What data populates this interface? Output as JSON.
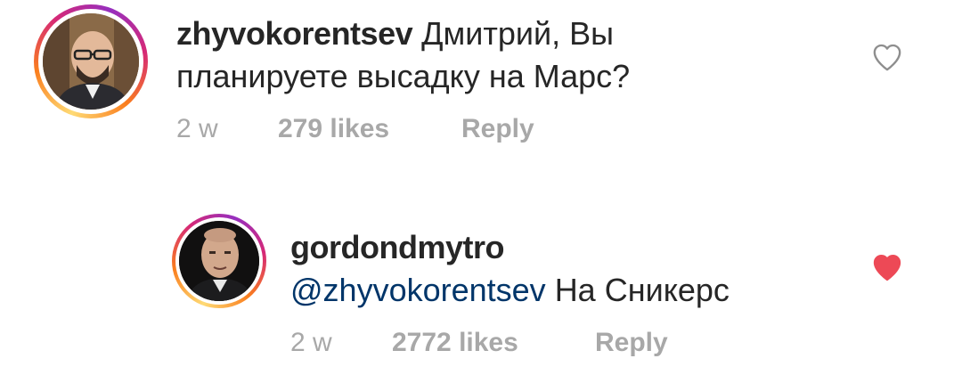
{
  "comments": [
    {
      "username": "zhyvokorentsev",
      "mention": "",
      "text_line1": "Дмитрий, Вы",
      "text_line2": "планируете высадку на Марс?",
      "time": "2 w",
      "likes": "279 likes",
      "reply_label": "Reply",
      "liked": false,
      "avatar_icon": "user-avatar"
    },
    {
      "username": "gordondmytro",
      "mention": "@zhyvokorentsev",
      "text": "На Сникерс",
      "time": "2 w",
      "likes": "2772 likes",
      "reply_label": "Reply",
      "liked": true,
      "avatar_icon": "user-avatar"
    }
  ],
  "colors": {
    "heart_liked": "#ed4956",
    "heart_outline": "#8e8e8e",
    "mention": "#003569",
    "meta": "#a8a8a8"
  }
}
